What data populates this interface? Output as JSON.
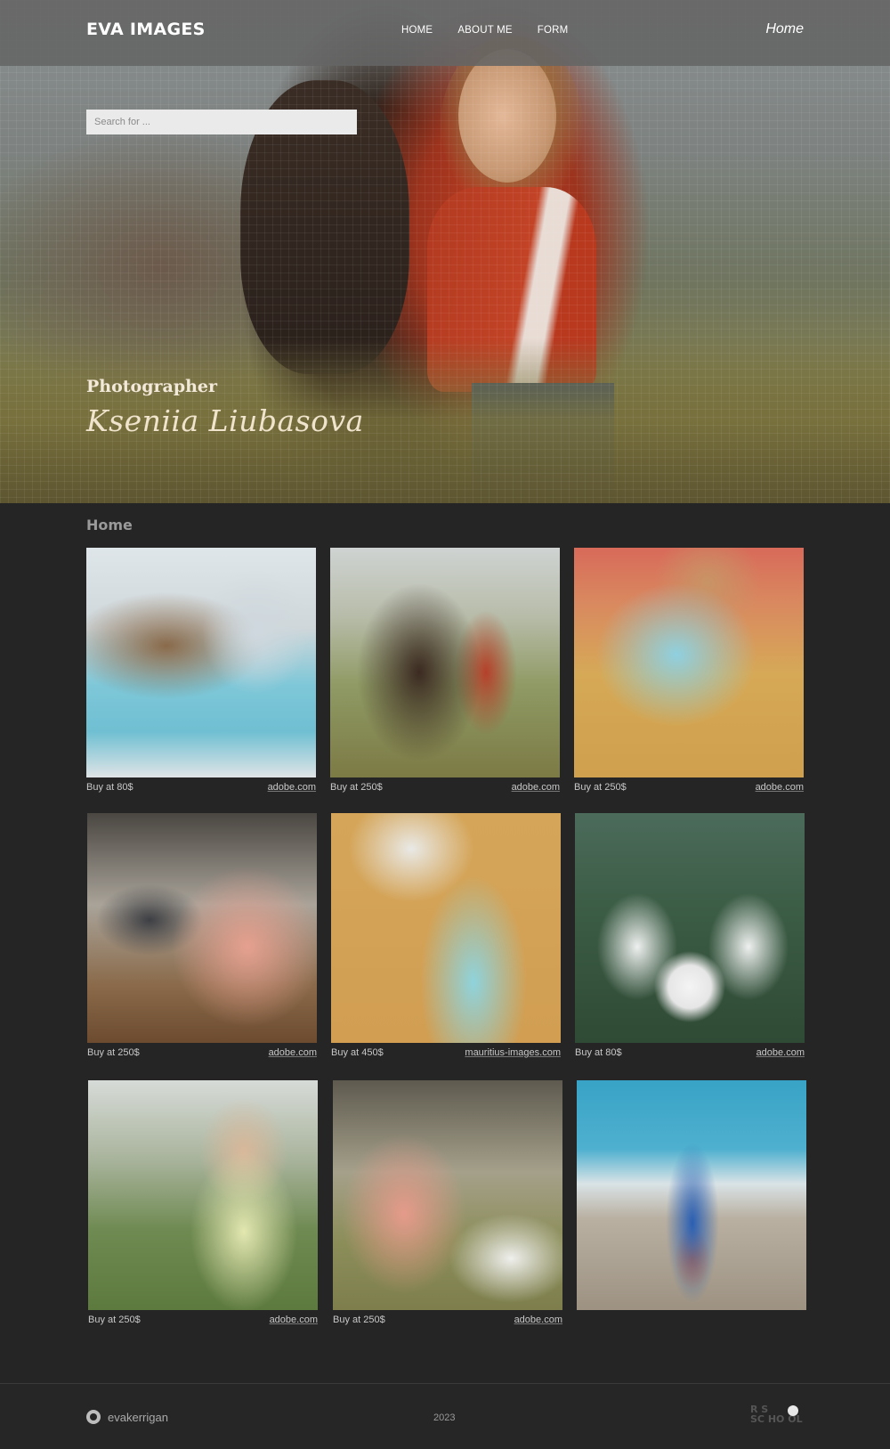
{
  "navbar": {
    "logo": "EVA IMAGES",
    "links": [
      {
        "label": "HOME"
      },
      {
        "label": "ABOUT ME"
      },
      {
        "label": "FORM"
      }
    ],
    "current_page": "Home"
  },
  "search": {
    "placeholder": "Search for ..."
  },
  "hero": {
    "subtitle": "Photographer",
    "name": "Kseniia Liubasova"
  },
  "section": {
    "title": "Home"
  },
  "gallery": [
    {
      "price": "Buy at 80$",
      "source": "adobe.com"
    },
    {
      "price": "Buy at 250$",
      "source": "adobe.com"
    },
    {
      "price": "Buy at 250$",
      "source": "adobe.com"
    },
    {
      "price": "Buy at 250$",
      "source": "adobe.com"
    },
    {
      "price": "Buy at 450$",
      "source": "mauritius-images.com"
    },
    {
      "price": "Buy at 80$",
      "source": "adobe.com"
    },
    {
      "price": "Buy at 250$",
      "source": "adobe.com"
    },
    {
      "price": "Buy at 250$",
      "source": "adobe.com"
    },
    {
      "price": "",
      "source": ""
    }
  ],
  "footer": {
    "github_user": "evakerrigan",
    "year": "2023",
    "logo_text": "RS SCHOOL",
    "logo_top": "R  S",
    "logo_bottom": "SC HO OL"
  }
}
